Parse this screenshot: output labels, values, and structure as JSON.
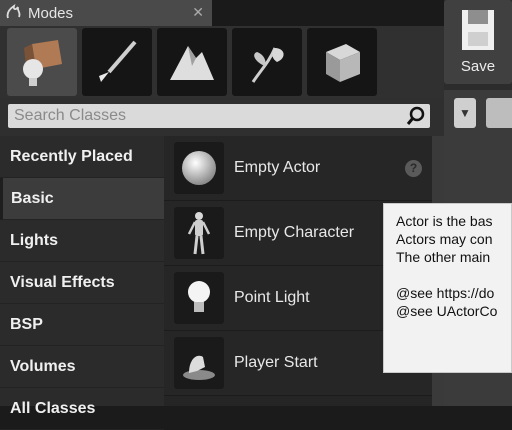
{
  "panel": {
    "tab_title": "Modes",
    "tab_icon": "ue-logo-icon",
    "tab_close": "✕",
    "modes": [
      {
        "name": "place-mode",
        "icon": "cube-sphere-icon"
      },
      {
        "name": "paint-mode",
        "icon": "paintbrush-icon"
      },
      {
        "name": "landscape-mode",
        "icon": "mountain-icon"
      },
      {
        "name": "foliage-mode",
        "icon": "leaf-icon"
      },
      {
        "name": "geometry-mode",
        "icon": "wire-cube-icon"
      }
    ],
    "search_placeholder": "Search Classes",
    "categories": [
      "Recently Placed",
      "Basic",
      "Lights",
      "Visual Effects",
      "BSP",
      "Volumes",
      "All Classes"
    ],
    "items": [
      {
        "label": "Empty Actor",
        "icon": "sphere-icon",
        "help": "?"
      },
      {
        "label": "Empty Character",
        "icon": "mannequin-icon",
        "help": ""
      },
      {
        "label": "Point Light",
        "icon": "lightbulb-icon",
        "help": ""
      },
      {
        "label": "Player Start",
        "icon": "player-start-icon",
        "help": ""
      }
    ]
  },
  "toolbar": {
    "save_label": "Save",
    "dropdown_arrow": "▼"
  },
  "tooltip": {
    "lines": [
      "Actor is the bas",
      "Actors may con",
      "The other main",
      "",
      "@see https://do",
      "@see UActorCo"
    ]
  },
  "colors": {
    "panel_bg": "#3a3a3a",
    "selected_mode": "#4b4b4b",
    "tooltip_bg": "#f2f2f2"
  }
}
